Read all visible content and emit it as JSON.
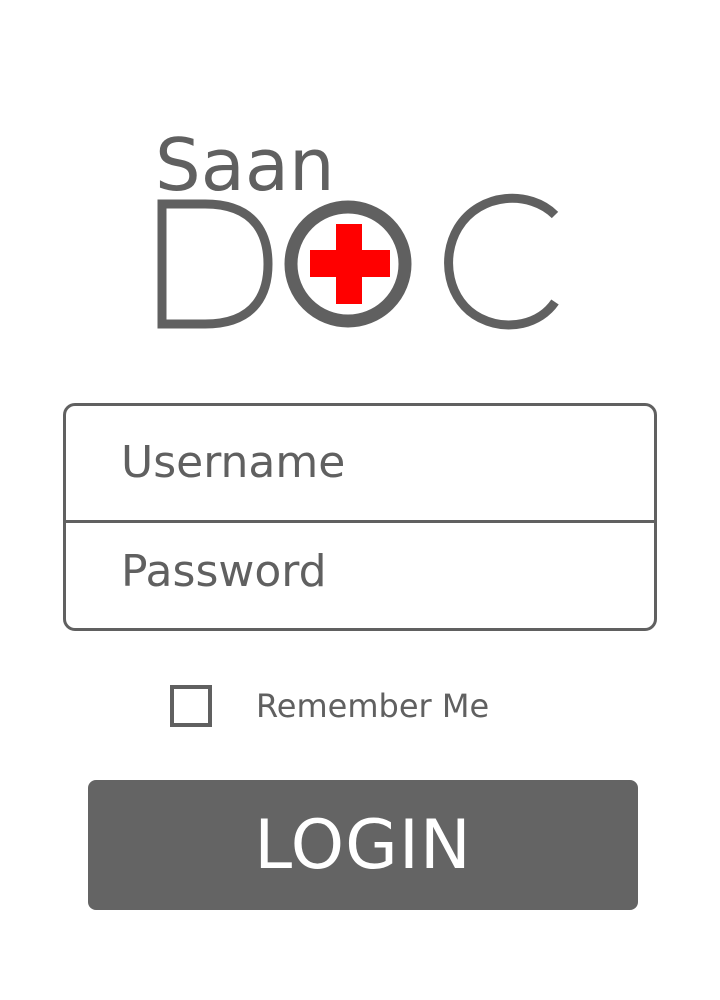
{
  "brand": {
    "top_word": "Saan",
    "bottom_word": "DOC",
    "accent_color": "#ff0000",
    "text_color": "#606060",
    "icon": "medical-cross-icon"
  },
  "form": {
    "username_placeholder": "Username",
    "password_placeholder": "Password",
    "remember_label": "Remember Me",
    "remember_checked": false,
    "login_label": "LOGIN",
    "button_color": "#646464"
  }
}
